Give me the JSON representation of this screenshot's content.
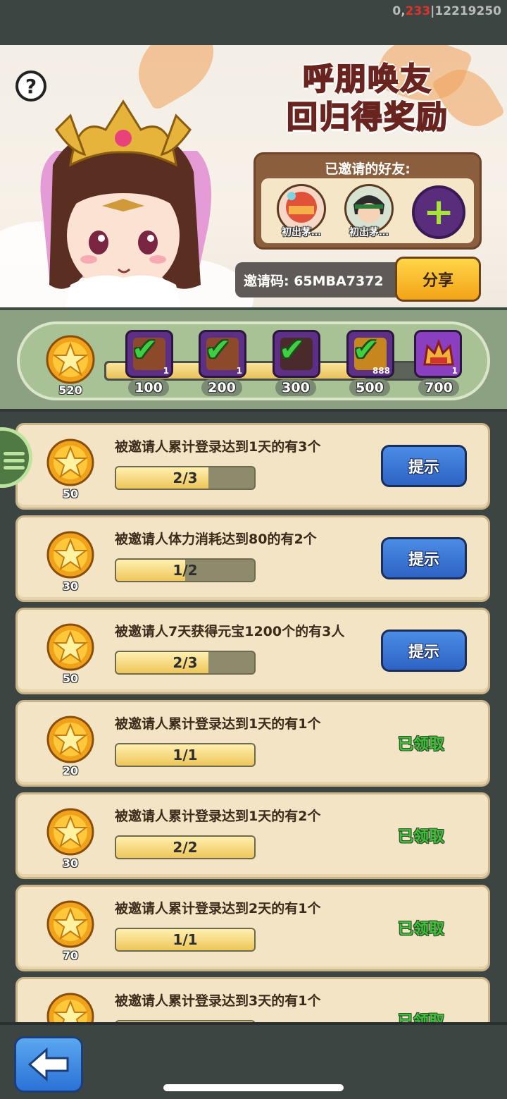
{
  "debug": {
    "prefix": "0,",
    "red": "233",
    "suffix": "|12219250"
  },
  "banner": {
    "title_line1": "呼朋唤友",
    "title_line2": "回归得奖励",
    "help_label": "?",
    "invited_title": "已邀请的好友:",
    "friends": [
      {
        "name": "初出茅…"
      },
      {
        "name": "初出茅…"
      }
    ],
    "add_label": "+",
    "invite_code": "邀请码: 65MBA7372",
    "share_label": "分享"
  },
  "progress": {
    "current": "520",
    "fill_fraction": 0.78,
    "milestones": [
      {
        "label": "100",
        "count": "1",
        "claimed": true
      },
      {
        "label": "200",
        "count": "1",
        "claimed": true
      },
      {
        "label": "300",
        "count": "",
        "claimed": true
      },
      {
        "label": "500",
        "count": "888",
        "claimed": true
      },
      {
        "label": "700",
        "count": "1",
        "claimed": false
      }
    ]
  },
  "tasks": [
    {
      "reward": "50",
      "desc": "被邀请人累计登录达到1天的有3个",
      "progress": "2/3",
      "fraction": 0.667,
      "action": "提示",
      "status": "hint"
    },
    {
      "reward": "30",
      "desc": "被邀请人体力消耗达到80的有2个",
      "progress": "1/2",
      "fraction": 0.5,
      "action": "提示",
      "status": "hint"
    },
    {
      "reward": "50",
      "desc": "被邀请人7天获得元宝1200个的有3人",
      "progress": "2/3",
      "fraction": 0.667,
      "action": "提示",
      "status": "hint"
    },
    {
      "reward": "20",
      "desc": "被邀请人累计登录达到1天的有1个",
      "progress": "1/1",
      "fraction": 1.0,
      "action": "已领取",
      "status": "claimed"
    },
    {
      "reward": "30",
      "desc": "被邀请人累计登录达到1天的有2个",
      "progress": "2/2",
      "fraction": 1.0,
      "action": "已领取",
      "status": "claimed"
    },
    {
      "reward": "70",
      "desc": "被邀请人累计登录达到2天的有1个",
      "progress": "1/1",
      "fraction": 1.0,
      "action": "已领取",
      "status": "claimed"
    },
    {
      "reward": "",
      "desc": "被邀请人累计登录达到3天的有1个",
      "progress": "",
      "fraction": 1.0,
      "action": "已领取",
      "status": "claimed"
    }
  ],
  "colors": {
    "accent_green": "#3fc23a",
    "hint_blue": "#2e63c4",
    "share_yellow": "#f3a316"
  }
}
